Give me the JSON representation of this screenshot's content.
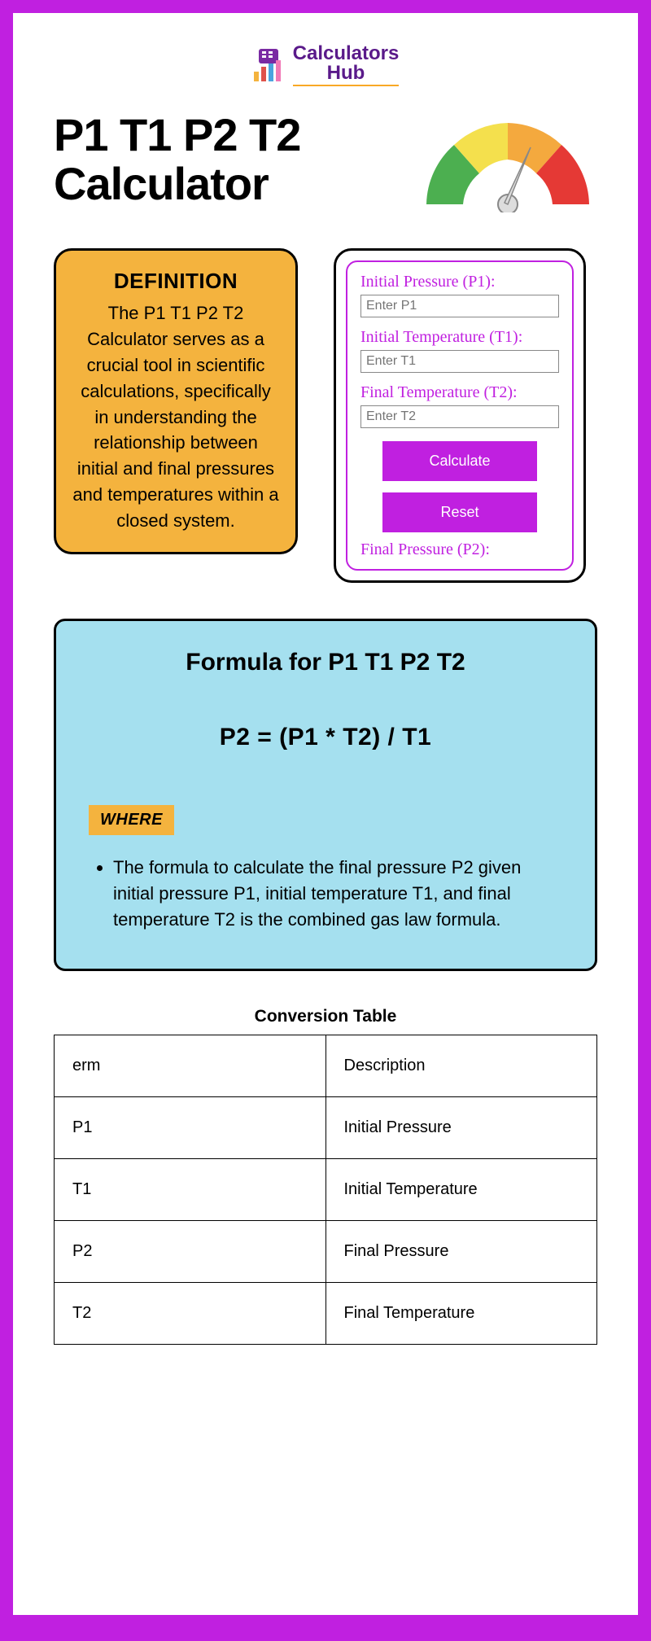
{
  "logo": {
    "text1": "Calculators",
    "text2": "Hub"
  },
  "title": "P1 T1 P2 T2 Calculator",
  "definition": {
    "heading": "DEFINITION",
    "body": "The P1 T1 P2 T2 Calculator serves as a crucial tool in scientific calculations, specifically in understanding the relationship between initial and final pressures and temperatures within a closed system."
  },
  "calculator": {
    "p1_label": "Initial Pressure (P1):",
    "p1_placeholder": "Enter P1",
    "t1_label": "Initial Temperature (T1):",
    "t1_placeholder": "Enter T1",
    "t2_label": "Final Temperature (T2):",
    "t2_placeholder": "Enter T2",
    "calculate_label": "Calculate",
    "reset_label": "Reset",
    "result_label": "Final Pressure (P2):"
  },
  "formula": {
    "heading": "Formula for P1 T1 P2 T2",
    "equation": "P2 = (P1 * T2) / T1",
    "where_label": "WHERE",
    "description": "The formula to calculate the final pressure P2 given initial pressure P1, initial temperature T1, and final temperature T2 is the combined gas law formula."
  },
  "table": {
    "title": "Conversion Table",
    "rows": [
      {
        "c1": "erm",
        "c2": "Description"
      },
      {
        "c1": "P1",
        "c2": "Initial Pressure"
      },
      {
        "c1": "T1",
        "c2": "Initial Temperature"
      },
      {
        "c1": "P2",
        "c2": "Final Pressure"
      },
      {
        "c1": "T2",
        "c2": "Final Temperature"
      }
    ]
  }
}
